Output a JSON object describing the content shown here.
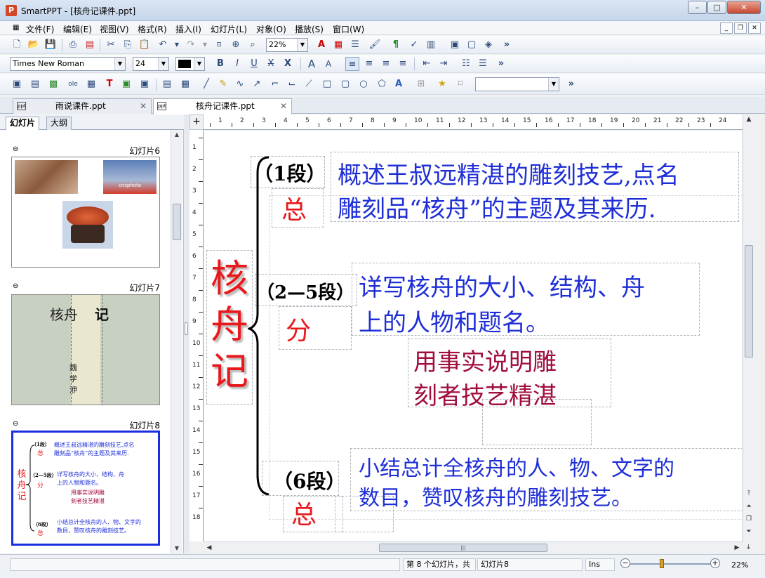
{
  "window": {
    "title": "SmartPPT - [核舟记课件.ppt]",
    "app_icon": "P"
  },
  "menu": [
    "文件(F)",
    "编辑(E)",
    "视图(V)",
    "格式(R)",
    "插入(I)",
    "幻灯片(L)",
    "对象(O)",
    "播放(S)",
    "窗口(W)"
  ],
  "toolbar": {
    "zoom": "22%",
    "font_name": "Times New Roman",
    "font_size": "24",
    "overflow": "»"
  },
  "tabs": [
    {
      "label": "雨说课件.ppt",
      "active": false
    },
    {
      "label": "核舟记课件.ppt",
      "active": true
    }
  ],
  "left_panel": {
    "tabs": [
      "幻灯片",
      "大纲"
    ],
    "slides": [
      {
        "label": "幻灯片6",
        "photo_caption": "cnsphoto"
      },
      {
        "label": "幻灯片7",
        "title_a": "核舟",
        "title_b": "记",
        "author": [
          "魏",
          "学",
          "洢"
        ]
      },
      {
        "label": "幻灯片8"
      }
    ]
  },
  "ruler": {
    "h": [
      "1",
      "2",
      "3",
      "4",
      "5",
      "6",
      "7",
      "8",
      "9",
      "10",
      "11",
      "12",
      "13",
      "14",
      "15",
      "16",
      "17",
      "18",
      "19",
      "20",
      "21",
      "22",
      "23",
      "24"
    ],
    "v": [
      "1",
      "2",
      "3",
      "4",
      "5",
      "6",
      "7",
      "8",
      "9",
      "10",
      "11",
      "12",
      "13",
      "14",
      "15",
      "16",
      "17",
      "18"
    ]
  },
  "slide": {
    "title_chars": [
      "核",
      "舟",
      "记"
    ],
    "sections": [
      {
        "para": "（1段）",
        "tag": "总",
        "line1": "概述王叔远精湛的雕刻技艺,点名",
        "line2": "雕刻品“核舟”的主题及其来历."
      },
      {
        "para": "（2—5段）",
        "tag": "分",
        "line1": "详写核舟的大小、结构、舟",
        "line2": "上的人物和题名。"
      },
      {
        "para": "（6段）",
        "tag": "总",
        "line1": "小结总计全核舟的人、物、文字的",
        "line2": "数目，赞叹核舟的雕刻技艺。"
      }
    ],
    "note_line1": "用事实说明雕",
    "note_line2": "刻者技艺精湛"
  },
  "status": {
    "slide_info": "第 8 个幻灯片，共",
    "slide_name": "幻灯片8",
    "mode": "Ins",
    "zoom": "22%"
  },
  "colors": {
    "blue": "#1f2fd6",
    "red": "#e8191c",
    "maroon": "#a10e3c"
  }
}
